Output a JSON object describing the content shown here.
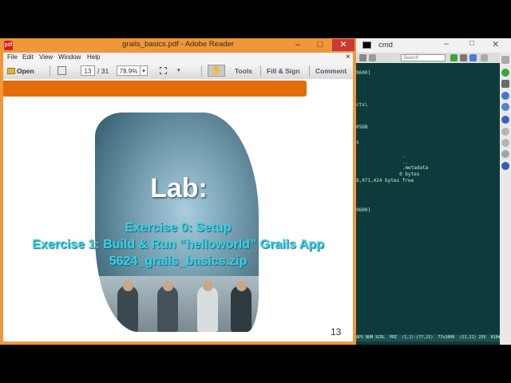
{
  "reader": {
    "window_title": "grails_basics.pdf - Adobe Reader",
    "logo": "pdf",
    "minimize_icon": "–",
    "maximize_icon": "□",
    "close_icon": "✕",
    "menu": [
      "File",
      "Edit",
      "View",
      "Window",
      "Help"
    ],
    "menu_close": "×",
    "toolbar": {
      "open_label": "Open",
      "page_current": "13",
      "page_total": "/ 31",
      "zoom": "78.9%",
      "zoom_arrow": "▾",
      "tools_label": "Tools",
      "fill_sign_label": "Fill & Sign",
      "comment_label": "Comment",
      "hand_icon": "✋",
      "pan_arrow": "▾"
    },
    "slide": {
      "title": "Lab:",
      "line1": "Exercise 0: Setup",
      "line2": "Exercise 1: Build & Run “helloworld” Grails App",
      "line3": "5624_grails_basics.zip",
      "page_number": "13"
    }
  },
  "cmd": {
    "window_title": "cmd",
    "minimize_icon": "–",
    "maximize_icon": "□",
    "close_icon": "✕",
    "search_placeholder": "Search",
    "lines": [
      {
        "text": "9600]"
      },
      {
        "text": "cts\\"
      },
      {
        "text": "05DB"
      },
      {
        "text": "s"
      },
      {
        "text": "                ."
      },
      {
        "text": "                .."
      },
      {
        "text": "                .metadata"
      },
      {
        "text": "               0 bytes"
      },
      {
        "text": "8,071,424 bytes free"
      },
      {
        "text": "9600]"
      }
    ],
    "status_bar": "APS NUM SCRL  PRI  (1,1)-(77,21)  77x1000  (21,21) 25V  8104"
  }
}
